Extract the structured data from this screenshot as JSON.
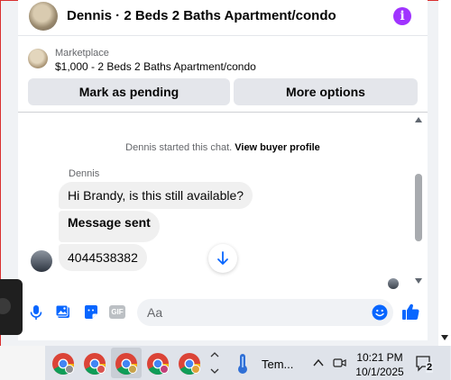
{
  "header": {
    "title": "Dennis · 2 Beds 2 Baths Apartment/condo",
    "info_icon": "info-icon",
    "info_glyph": "i",
    "accent": "#a033ff"
  },
  "marketplace": {
    "label": "Marketplace",
    "listing": "$1,000 - 2 Beds 2 Baths Apartment/condo"
  },
  "actions": {
    "mark_pending": "Mark as pending",
    "more_options": "More options"
  },
  "chat": {
    "system_text": "Dennis started this chat.",
    "system_link": "View buyer profile",
    "sender_name": "Dennis",
    "messages": [
      {
        "text": "Hi Brandy, is this still available?"
      },
      {
        "text": "Message sent"
      },
      {
        "text": "4044538382"
      }
    ]
  },
  "composer": {
    "placeholder": "Aa",
    "icons": [
      "microphone-icon",
      "photo-icon",
      "sticker-icon",
      "gif-icon",
      "emoji-icon",
      "thumbs-up-icon"
    ],
    "gif_label": "GIF",
    "accent": "#0866ff"
  },
  "taskbar": {
    "apps": [
      "chrome-icon",
      "chrome-icon",
      "chrome-icon",
      "chrome-icon",
      "chrome-icon"
    ],
    "weather_text": "Tem...",
    "time": "10:21 PM",
    "date": "10/1/2025",
    "notifications": "2"
  }
}
